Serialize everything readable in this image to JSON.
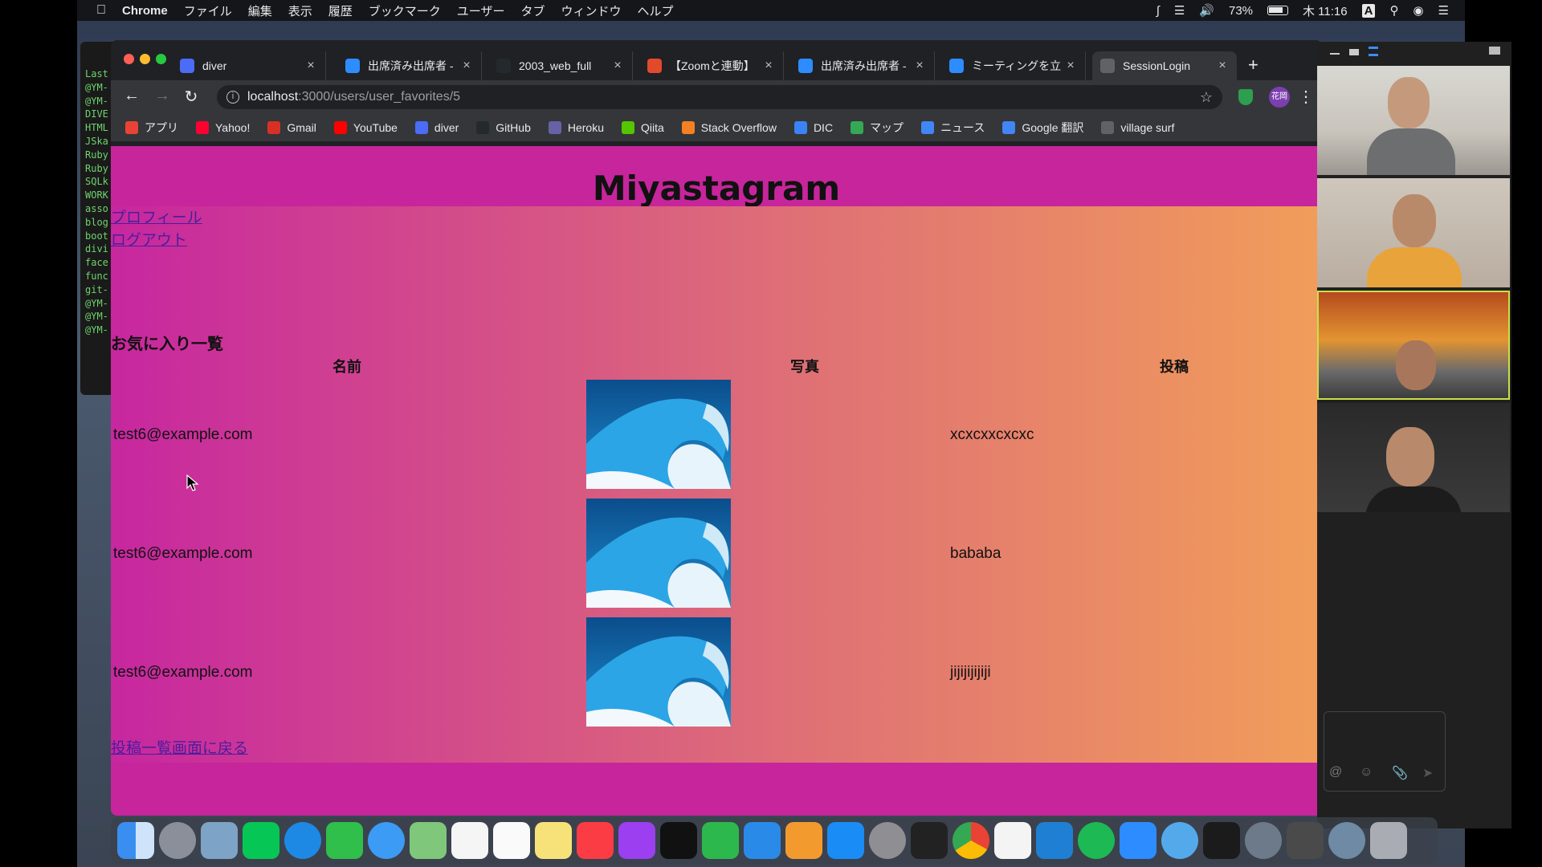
{
  "menubar": {
    "app_name": "Chrome",
    "menus": [
      "ファイル",
      "編集",
      "表示",
      "履歴",
      "ブックマーク",
      "ユーザー",
      "タブ",
      "ウィンドウ",
      "ヘルプ"
    ],
    "battery": "73%",
    "clock": "木 11:16",
    "input_mode": "A"
  },
  "terminal": {
    "lines": [
      "Last",
      "@YM-",
      "@YM-",
      "DIVE",
      "HTML",
      "JSka",
      "Ruby",
      "Ruby",
      "SQLk",
      "WORK",
      "asso",
      "blog",
      "boot",
      "divi",
      "face",
      "func",
      "git-",
      "@YM-",
      "@YM-",
      "@YM-"
    ]
  },
  "browser": {
    "tabs": [
      {
        "title": "diver",
        "icon": "diver-icon",
        "color": "#4a6cf7"
      },
      {
        "title": "出席済み出席者 -",
        "icon": "zoom-icon",
        "color": "#2d8cff"
      },
      {
        "title": "2003_web_full",
        "icon": "github-icon",
        "color": "#24292e"
      },
      {
        "title": "【Zoomと連動】",
        "icon": "tekunokan-icon",
        "color": "#e34a2c"
      },
      {
        "title": "出席済み出席者 -",
        "icon": "zoom-icon",
        "color": "#2d8cff"
      },
      {
        "title": "ミーティングを立",
        "icon": "zoom-icon",
        "color": "#2d8cff"
      },
      {
        "title": "SessionLogin",
        "icon": "globe-icon",
        "color": "#5f6368"
      }
    ],
    "active_tab": 6,
    "url_host": "localhost",
    "url_path": ":3000/users/user_favorites/5",
    "profile_badge": "花岡",
    "bookmarks": [
      {
        "label": "アプリ",
        "icon": "apps-grid-icon",
        "color": "#ea4335"
      },
      {
        "label": "Yahoo!",
        "icon": "yahoo-icon",
        "color": "#ff0033"
      },
      {
        "label": "Gmail",
        "icon": "gmail-icon",
        "color": "#d93025"
      },
      {
        "label": "YouTube",
        "icon": "youtube-icon",
        "color": "#ff0000"
      },
      {
        "label": "diver",
        "icon": "diver-icon",
        "color": "#4a6cf7"
      },
      {
        "label": "GitHub",
        "icon": "github-icon",
        "color": "#24292e"
      },
      {
        "label": "Heroku",
        "icon": "heroku-icon",
        "color": "#6762a6"
      },
      {
        "label": "Qiita",
        "icon": "qiita-icon",
        "color": "#55c500"
      },
      {
        "label": "Stack Overflow",
        "icon": "stackoverflow-icon",
        "color": "#f48024"
      },
      {
        "label": "DIC",
        "icon": "dic-icon",
        "color": "#3b82f6"
      },
      {
        "label": "マップ",
        "icon": "maps-icon",
        "color": "#34a853"
      },
      {
        "label": "ニュース",
        "icon": "news-icon",
        "color": "#4285f4"
      },
      {
        "label": "Google 翻訳",
        "icon": "translate-icon",
        "color": "#4285f4"
      },
      {
        "label": "village surf",
        "icon": "globe-icon",
        "color": "#5f6368"
      }
    ]
  },
  "page": {
    "site_title": "Miyastagram",
    "nav_links": [
      "プロフィール",
      "ログアウト"
    ],
    "section_title": "お気に入り一覧",
    "columns": [
      "名前",
      "写真",
      "投稿"
    ],
    "rows": [
      {
        "name": "test6@example.com",
        "photo": "wave-image",
        "post": "xcxcxxcxcxc"
      },
      {
        "name": "test6@example.com",
        "photo": "wave-image",
        "post": "bababa"
      },
      {
        "name": "test6@example.com",
        "photo": "wave-image",
        "post": "jijijijijiji"
      }
    ],
    "back_link": "投稿一覧画面に戻る",
    "colors": {
      "header": "#c7259c",
      "gradient_start": "#c7279f",
      "gradient_end": "#f19d5a",
      "link": "#4b1e9c"
    }
  },
  "zoom": {
    "participants": 4
  }
}
